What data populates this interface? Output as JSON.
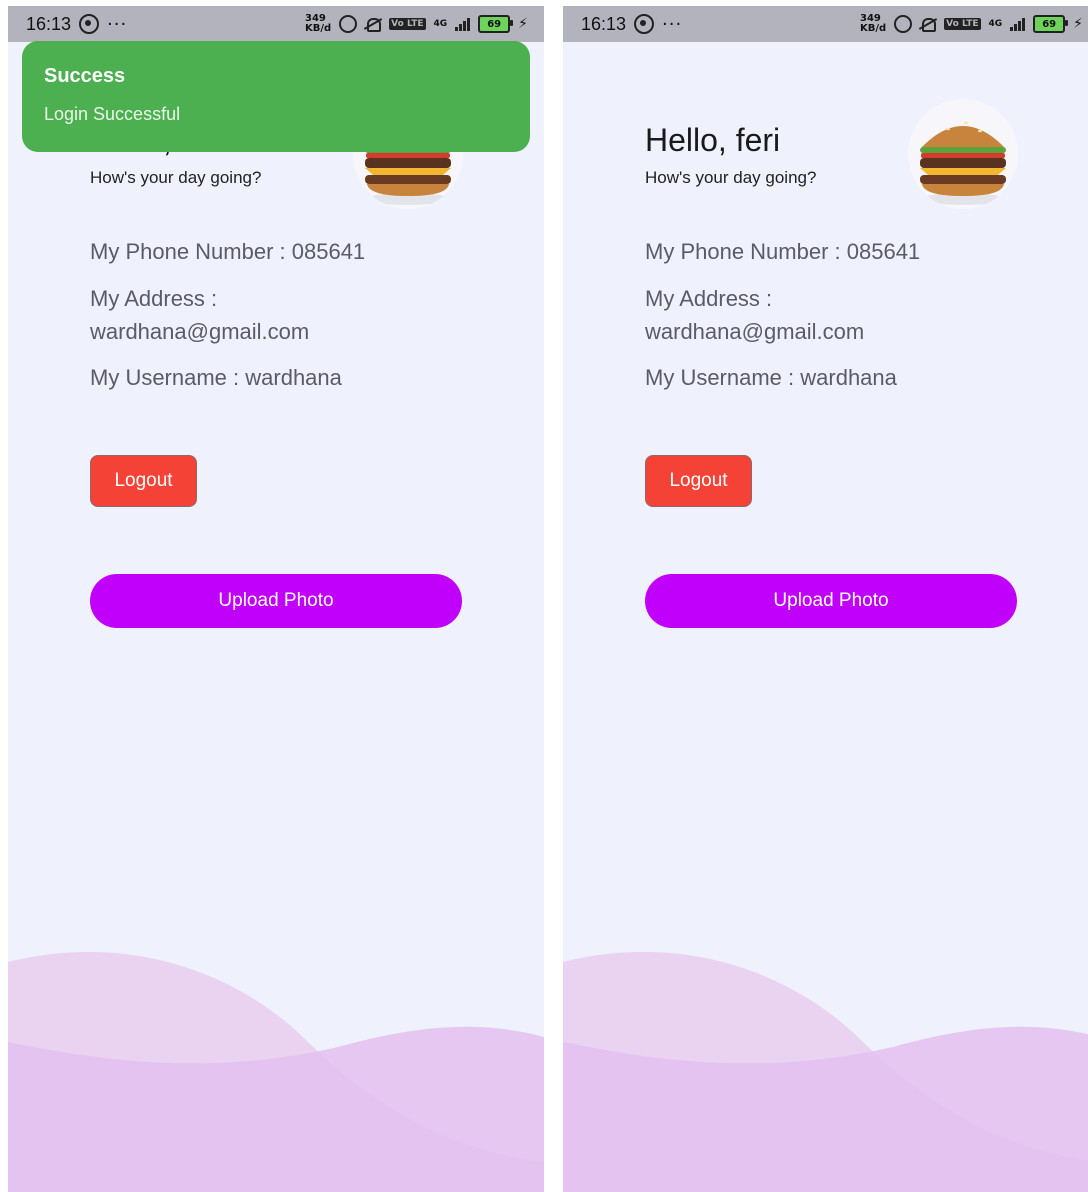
{
  "statusbar": {
    "time": "16:13",
    "dots": "···",
    "speed_value": "349",
    "speed_unit": "KB/d",
    "volte": "Vo LTE",
    "network": "4G",
    "battery": "69"
  },
  "profile": {
    "greeting": "Hello, feri",
    "subtitle": "How's your day going?",
    "phone_line": "My Phone Number : 085641",
    "address_line": "My Address : wardhana@gmail.com",
    "username_line": "My Username : wardhana",
    "avatar_icon": "burger-image"
  },
  "buttons": {
    "logout": "Logout",
    "upload": "Upload Photo"
  },
  "toast": {
    "title": "Success",
    "message": "Login Successful",
    "color": "#4caf50"
  },
  "colors": {
    "background": "#eff1fd",
    "logout": "#f44336",
    "upload": "#c000fa",
    "wave_light": "#e9d3f0",
    "wave_dark": "#e3c0f0"
  }
}
